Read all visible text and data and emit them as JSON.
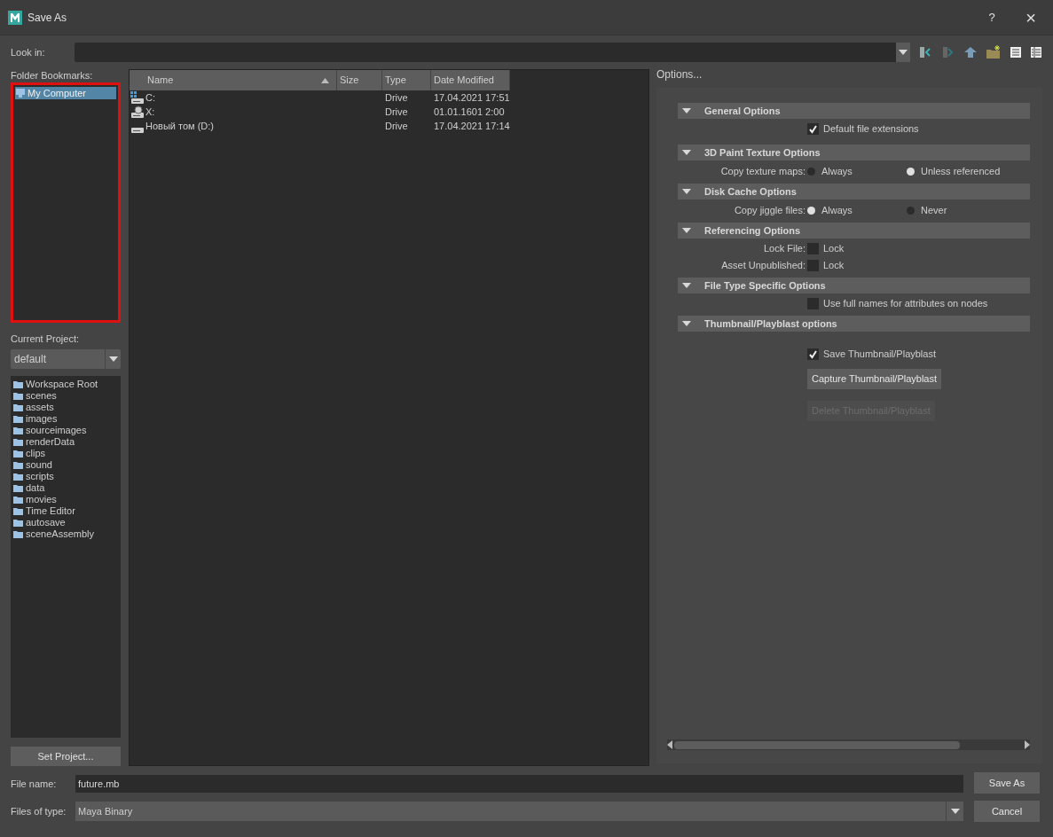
{
  "window": {
    "title": "Save As",
    "help": "?",
    "close": "×"
  },
  "look_in": {
    "label": "Look in:"
  },
  "bookmarks": {
    "label": "Folder Bookmarks:",
    "items": [
      {
        "text": "My Computer",
        "selected": true
      }
    ]
  },
  "project": {
    "label": "Current Project:",
    "value": "default",
    "folders": [
      "Workspace Root",
      "scenes",
      "assets",
      "images",
      "sourceimages",
      "renderData",
      "clips",
      "sound",
      "scripts",
      "data",
      "movies",
      "Time Editor",
      "autosave",
      "sceneAssembly"
    ],
    "set_button": "Set Project..."
  },
  "table": {
    "columns": [
      {
        "label": "Name",
        "sorted": true
      },
      {
        "label": "Size",
        "sorted": false
      },
      {
        "label": "Type",
        "sorted": false
      },
      {
        "label": "Date Modified",
        "sorted": false
      }
    ],
    "rows": [
      {
        "kind": "system",
        "name": "C:",
        "size": "",
        "type": "Drive",
        "date": "17.04.2021 17:51"
      },
      {
        "kind": "network",
        "name": "X:",
        "type": "Drive",
        "date": "01.01.1601 2:00"
      },
      {
        "kind": "drive",
        "name": "Новый том (D:)",
        "type": "Drive",
        "date": "17.04.2021 17:14"
      }
    ]
  },
  "options": {
    "title": "Options...",
    "sections": [
      {
        "title": "General Options",
        "expanded": true,
        "rows": [
          {
            "kind": "checkbox",
            "text": "Default file extensions",
            "checked": true
          }
        ]
      },
      {
        "title": "3D Paint Texture Options",
        "expanded": true,
        "rows": [
          {
            "kind": "radio",
            "label": "Copy texture maps:",
            "choices": [
              {
                "text": "Always",
                "selected": false
              },
              {
                "text": "Unless referenced",
                "selected": true
              }
            ]
          }
        ]
      },
      {
        "title": "Disk Cache Options",
        "expanded": true,
        "rows": [
          {
            "kind": "radio",
            "label": "Copy jiggle files:",
            "choices": [
              {
                "text": "Always",
                "selected": true
              },
              {
                "text": "Never",
                "selected": false
              }
            ]
          }
        ]
      },
      {
        "title": "Referencing Options",
        "expanded": true,
        "rows": [
          {
            "kind": "checkbox",
            "label": "Lock File:",
            "text": "Lock",
            "checked": false
          },
          {
            "kind": "checkbox",
            "label": "Asset Unpublished:",
            "text": "Lock",
            "checked": false
          }
        ]
      },
      {
        "title": "File Type Specific Options",
        "expanded": true,
        "rows": [
          {
            "kind": "checkbox",
            "text": "Use full names for attributes on nodes",
            "checked": false
          }
        ]
      },
      {
        "title": "Thumbnail/Playblast options",
        "expanded": true,
        "rows": [
          {
            "kind": "checkbox",
            "text": "Save Thumbnail/Playblast",
            "checked": true
          },
          {
            "kind": "button",
            "text": "Capture Thumbnail/Playblast",
            "disabled": false
          },
          {
            "kind": "button",
            "text": "Delete Thumbnail/Playblast",
            "disabled": true
          }
        ]
      }
    ]
  },
  "file_name": {
    "label": "File name:",
    "value": "future.mb"
  },
  "file_type": {
    "label": "Files of type:",
    "value": "Maya Binary"
  },
  "buttons": [
    "Save As",
    "Cancel"
  ]
}
